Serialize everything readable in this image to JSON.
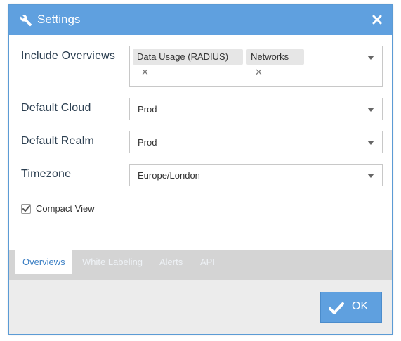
{
  "dialog": {
    "title": "Settings",
    "title_icon": "wrench-icon",
    "close_icon": "close-icon"
  },
  "form": {
    "include_overviews": {
      "label": "Include Overviews",
      "tags": [
        {
          "label": "Data Usage (RADIUS)"
        },
        {
          "label": "Networks"
        }
      ]
    },
    "default_cloud": {
      "label": "Default Cloud",
      "value": "Prod"
    },
    "default_realm": {
      "label": "Default Realm",
      "value": "Prod"
    },
    "timezone": {
      "label": "Timezone",
      "value": "Europe/London"
    },
    "compact_view": {
      "label": "Compact View",
      "checked": true
    }
  },
  "tabs": [
    {
      "label": "Overviews",
      "active": true
    },
    {
      "label": "White Labeling",
      "active": false
    },
    {
      "label": "Alerts",
      "active": false
    },
    {
      "label": "API",
      "active": false
    }
  ],
  "footer": {
    "ok_label": "OK",
    "ok_icon": "checkmark-icon"
  },
  "colors": {
    "accent": "#5fa0df",
    "label_text": "#2b3e50",
    "tab_active_text": "#3b7fc4"
  }
}
